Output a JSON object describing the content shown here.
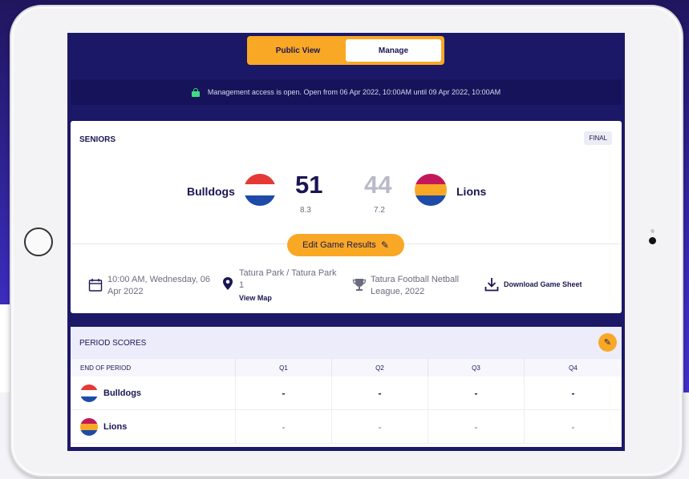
{
  "toggle": {
    "public_label": "Public View",
    "manage_label": "Manage"
  },
  "notice": {
    "text": "Management access is open. Open from 06 Apr 2022, 10:00AM until 09 Apr 2022, 10:00AM"
  },
  "match": {
    "grade": "SENIORS",
    "status": "FINAL",
    "home": {
      "name": "Bulldogs",
      "score": "51",
      "breakdown": "8.3",
      "colors": [
        "#e53935",
        "#ffffff",
        "#1e4aa8"
      ]
    },
    "away": {
      "name": "Lions",
      "score": "44",
      "breakdown": "7.2",
      "colors": [
        "#c2185b",
        "#f9a825",
        "#1e4aa8"
      ]
    },
    "edit_label": "Edit Game Results"
  },
  "info": {
    "datetime_line1": "10:00 AM, Wednesday, 06",
    "datetime_line2": "Apr 2022",
    "venue_line1": "Tatura Park / Tatura Park",
    "venue_line2": "1",
    "view_map": "View Map",
    "league_line1": "Tatura Football Netball",
    "league_line2": "League, 2022",
    "download": "Download Game Sheet"
  },
  "period_scores": {
    "title": "PERIOD SCORES",
    "columns": [
      "END OF PERIOD",
      "Q1",
      "Q2",
      "Q3",
      "Q4"
    ],
    "rows": [
      {
        "team": "Bulldogs",
        "values": [
          "-",
          "-",
          "-",
          "-"
        ]
      },
      {
        "team": "Lions",
        "values": [
          "-",
          "-",
          "-",
          "-"
        ]
      }
    ]
  }
}
